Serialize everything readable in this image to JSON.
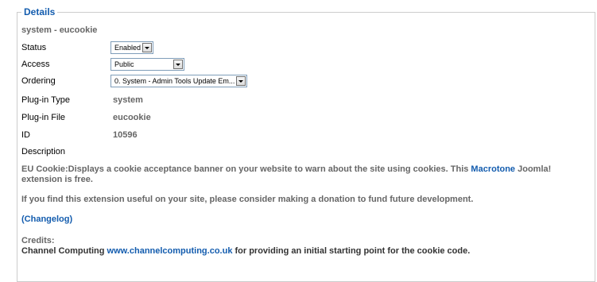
{
  "details": {
    "legend": "Details",
    "plugin_title": "system - eucookie",
    "fields": {
      "status": {
        "label": "Status",
        "value": "Enabled"
      },
      "access": {
        "label": "Access",
        "value": "Public"
      },
      "ordering": {
        "label": "Ordering",
        "value": "0. System - Admin Tools Update Em..."
      },
      "plugin_type": {
        "label": "Plug-in Type",
        "value": "system"
      },
      "plugin_file": {
        "label": "Plug-in File",
        "value": "eucookie"
      },
      "id": {
        "label": "ID",
        "value": "10596"
      }
    },
    "description_label": "Description"
  },
  "description": {
    "para1_before": "EU Cookie:Displays a cookie acceptance banner on your website to warn about the site using cookies. This ",
    "para1_link": "Macrotone",
    "para1_after": " Joomla! extension is free.",
    "para2": "If you find this extension useful on your site, please consider making a donation to fund future development.",
    "changelog_link": "(Changelog)",
    "credits_heading": "Credits:",
    "credits_before": "Channel Computing ",
    "credits_link": "www.channelcomputing.co.uk",
    "credits_after": " for providing an initial starting point for the cookie code."
  },
  "colors": {
    "accent": "#135cae",
    "value_text": "#666666",
    "border": "#cccccc"
  }
}
